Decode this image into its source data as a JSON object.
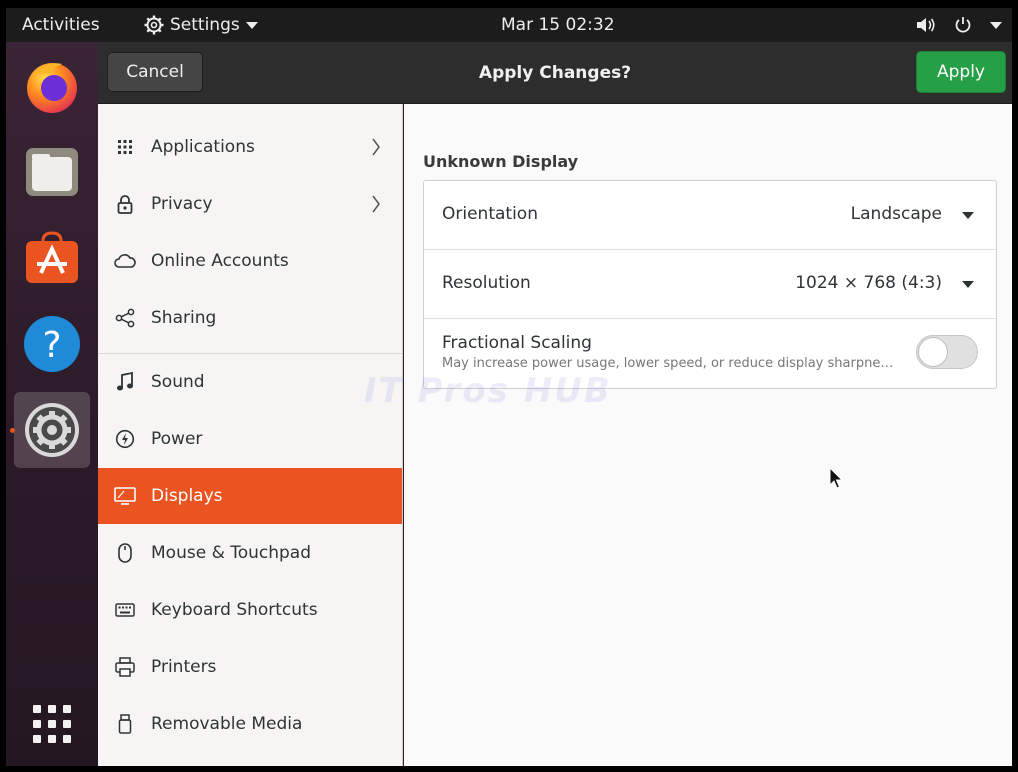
{
  "topbar": {
    "activities": "Activities",
    "app_menu": "Settings",
    "clock": "Mar 15  02:32"
  },
  "dock": {
    "apps": [
      {
        "name": "firefox-icon"
      },
      {
        "name": "files-icon"
      },
      {
        "name": "software-icon"
      },
      {
        "name": "help-icon"
      },
      {
        "name": "settings-icon",
        "active": true
      },
      {
        "name": "show-apps-icon"
      }
    ]
  },
  "header": {
    "cancel_label": "Cancel",
    "title": "Apply Changes?",
    "apply_label": "Apply",
    "apply_color": "#26a046"
  },
  "sidebar": {
    "items": [
      {
        "label": "Applications",
        "icon": "grid-icon",
        "has_submenu": true
      },
      {
        "label": "Privacy",
        "icon": "lock-icon",
        "has_submenu": true
      },
      {
        "label": "Online Accounts",
        "icon": "cloud-icon"
      },
      {
        "label": "Sharing",
        "icon": "share-icon"
      },
      {
        "label": "Sound",
        "icon": "music-note-icon"
      },
      {
        "label": "Power",
        "icon": "power-icon"
      },
      {
        "label": "Displays",
        "icon": "display-icon",
        "selected": true
      },
      {
        "label": "Mouse & Touchpad",
        "icon": "mouse-icon"
      },
      {
        "label": "Keyboard Shortcuts",
        "icon": "keyboard-icon"
      },
      {
        "label": "Printers",
        "icon": "printer-icon"
      },
      {
        "label": "Removable Media",
        "icon": "usb-icon"
      }
    ],
    "selected_color": "#e95420"
  },
  "display": {
    "name": "Unknown Display",
    "orientation_label": "Orientation",
    "orientation_value": "Landscape",
    "resolution_label": "Resolution",
    "resolution_value": "1024 × 768 (4:3)",
    "fractional_label": "Fractional Scaling",
    "fractional_sub": "May increase power usage, lower speed, or reduce display sharpness.",
    "fractional_enabled": false
  },
  "watermark": "IT Pros HUB"
}
